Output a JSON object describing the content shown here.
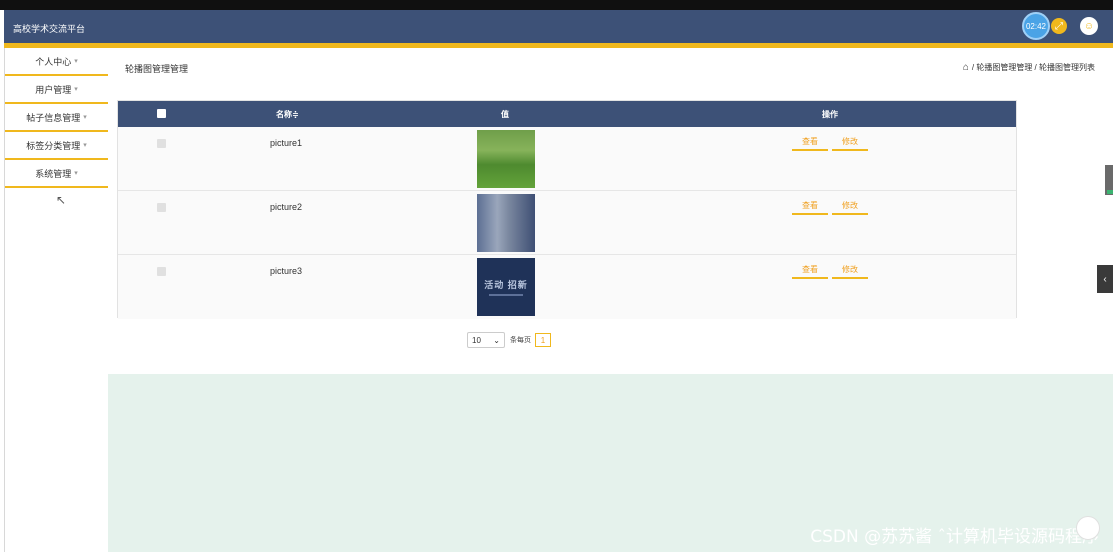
{
  "header": {
    "app_title": "高校学术交流平台",
    "timer": "02:42",
    "expand_icon": "expand-arrows-icon",
    "user_icon": "user-icon",
    "colors": {
      "bar": "#3d5177",
      "accent": "#f0b81d"
    }
  },
  "sidebar": {
    "items": [
      {
        "label": "个人中心"
      },
      {
        "label": "用户管理"
      },
      {
        "label": "帖子信息管理"
      },
      {
        "label": "标签分类管理"
      },
      {
        "label": "系统管理"
      }
    ],
    "caret": "▾"
  },
  "main": {
    "page_title": "轮播图管理管理",
    "breadcrumb": "/ 轮播图管理管理 / 轮播图管理列表",
    "table": {
      "headers": {
        "name": "名称≑",
        "value": "值",
        "actions": "操作"
      },
      "rows": [
        {
          "name": "picture1",
          "thumb": "campus-lawn-photo"
        },
        {
          "name": "picture2",
          "thumb": "buildings-photo"
        },
        {
          "name": "picture3",
          "thumb": "dark-blue-banner-image",
          "thumb_text": "活动 招新"
        }
      ],
      "view_label": "查看",
      "edit_label": "修改"
    },
    "pager": {
      "page_size": "10",
      "per_page_label": "条每页",
      "current_page": "1"
    }
  },
  "watermark": "CSDN @苏苏酱   ˆ计算机毕设源码程序"
}
